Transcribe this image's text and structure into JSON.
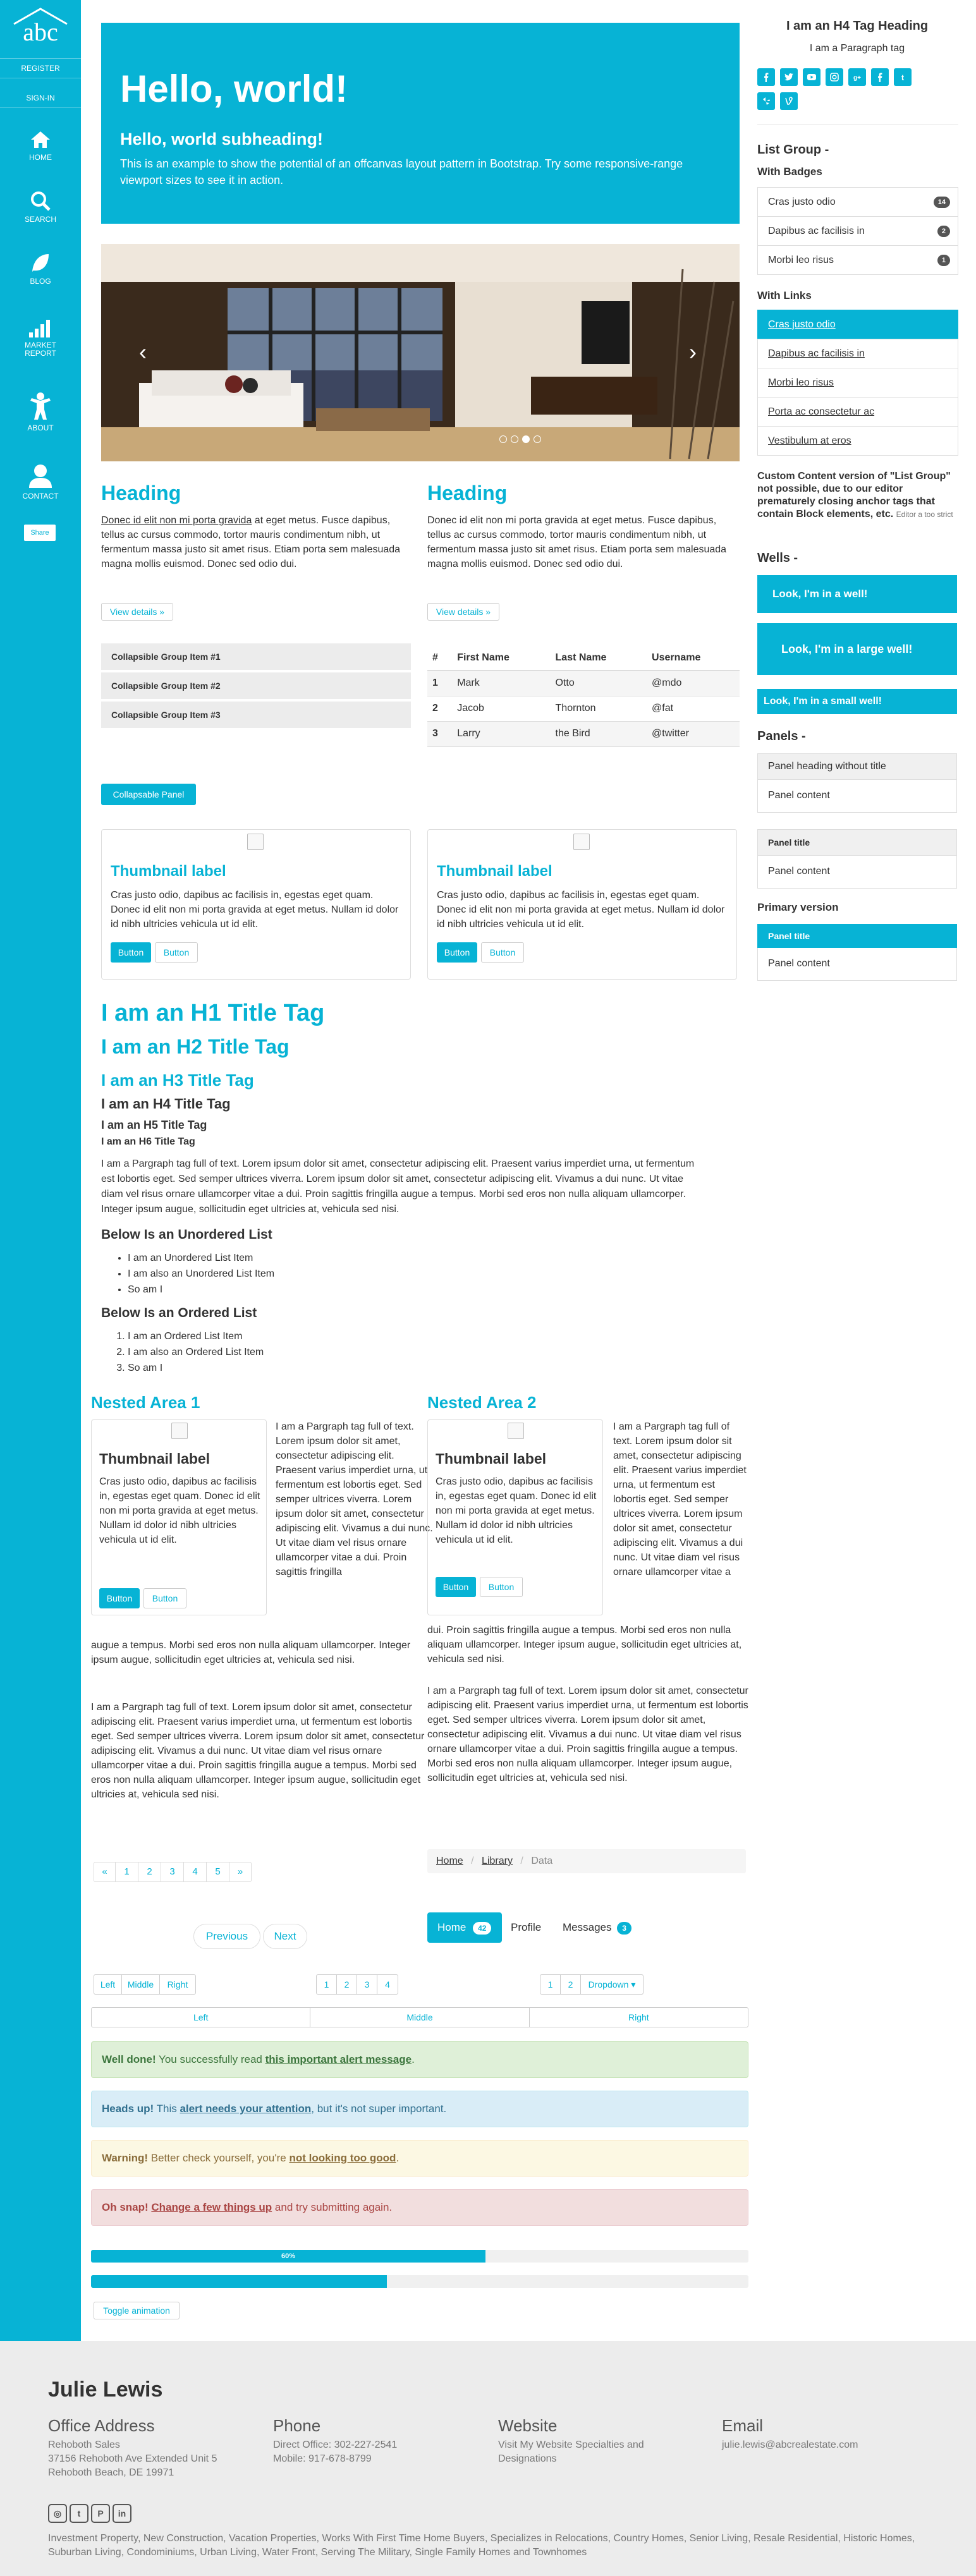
{
  "sidebar": {
    "logo_text": "abc",
    "register": "REGISTER",
    "signin": "SIGN-IN",
    "nav": [
      {
        "label": "HOME",
        "icon": "home-icon"
      },
      {
        "label": "SEARCH",
        "icon": "search-icon"
      },
      {
        "label": "BLOG",
        "icon": "leaf-icon"
      },
      {
        "label": "MARKET\nREPORT",
        "icon": "bar-chart-icon"
      },
      {
        "label": "ABOUT",
        "icon": "person-icon"
      },
      {
        "label": "CONTACT",
        "icon": "user-icon"
      }
    ],
    "share": "Share"
  },
  "jumbotron": {
    "title": "Hello, world!",
    "subtitle": "Hello, world subheading!",
    "text": "This is an example to show the potential of an offcanvas layout pattern in Bootstrap. Try some responsive-range viewport sizes to see it in action."
  },
  "columns": [
    {
      "heading": "Heading",
      "link": "Donec id elit non mi porta gravida",
      "text": " at eget metus. Fusce dapibus, tellus ac cursus commodo, tortor mauris condimentum nibh, ut fermentum massa justo sit amet risus. Etiam porta sem malesuada magna mollis euismod. Donec sed odio dui.",
      "button": "View details »"
    },
    {
      "heading": "Heading",
      "link": "",
      "text": "Donec id elit non mi porta gravida at eget metus. Fusce dapibus, tellus ac cursus commodo, tortor mauris condimentum nibh, ut fermentum massa justo sit amet risus. Etiam porta sem malesuada magna mollis euismod. Donec sed odio dui.",
      "button": "View details »"
    }
  ],
  "collapsible": [
    "Collapsible Group Item #1",
    "Collapsible Group Item #2",
    "Collapsible Group Item #3"
  ],
  "table": {
    "headers": [
      "#",
      "First Name",
      "Last Name",
      "Username"
    ],
    "rows": [
      [
        "1",
        "Mark",
        "Otto",
        "@mdo"
      ],
      [
        "2",
        "Jacob",
        "Thornton",
        "@fat"
      ],
      [
        "3",
        "Larry",
        "the Bird",
        "@twitter"
      ]
    ]
  },
  "collapsable_panel": "Collapsable Panel",
  "thumbnails": [
    {
      "title": "Thumbnail label",
      "text": "Cras justo odio, dapibus ac facilisis in, egestas eget quam. Donec id elit non mi porta gravida at eget metus. Nullam id dolor id nibh ultricies vehicula ut id elit.",
      "btn1": "Button",
      "btn2": "Button"
    },
    {
      "title": "Thumbnail label",
      "text": "Cras justo odio, dapibus ac facilisis in, egestas eget quam. Donec id elit non mi porta gravida at eget metus. Nullam id dolor id nibh ultricies vehicula ut id elit.",
      "btn1": "Button",
      "btn2": "Button"
    }
  ],
  "typography": {
    "h1": "I am an H1 Title Tag",
    "h2": "I am an H2 Title Tag",
    "h3": "I am an H3 Title Tag",
    "h4": "I am an H4 Title Tag",
    "h5": "I am an H5 Title Tag",
    "h6": "I am an H6 Title Tag",
    "paragraph": "I am a Pargraph tag full of text. Lorem ipsum dolor sit amet, consectetur adipiscing elit. Praesent varius imperdiet urna, ut fermentum est lobortis eget. Sed semper ultrices viverra. Lorem ipsum dolor sit amet, consectetur adipiscing elit. Vivamus a dui nunc. Ut vitae diam vel risus ornare ullamcorper vitae a dui. Proin sagittis fringilla augue a tempus. Morbi sed eros non nulla aliquam ullamcorper. Integer ipsum augue, sollicitudin eget ultricies at, vehicula sed nisi.",
    "ul_title": "Below Is an Unordered List",
    "ul": [
      "I am an Unordered List Item",
      "I am also an Unordered List Item",
      "So am I"
    ],
    "ol_title": "Below Is an Ordered List",
    "ol": [
      "I am an Ordered List Item",
      "I am also an Ordered List Item",
      "So am I"
    ]
  },
  "nested": [
    {
      "title": "Nested Area 1",
      "thumb_title": "Thumbnail label",
      "thumb_text": "Cras justo odio, dapibus ac facilisis in, egestas eget quam. Donec id elit non mi porta gravida at eget metus. Nullam id dolor id nibh ultricies vehicula ut id elit.",
      "btn1": "Button",
      "btn2": "Button",
      "side_text": "I am a Pargraph tag full of text. Lorem ipsum dolor sit amet, consectetur adipiscing elit. Praesent varius imperdiet urna, ut fermentum est lobortis eget. Sed semper ultrices viverra. Lorem ipsum dolor sit amet, consectetur adipiscing elit. Vivamus a dui nunc. Ut vitae diam vel risus ornare ullamcorper vitae a dui. Proin sagittis fringilla",
      "cont_text": "augue a tempus. Morbi sed eros non nulla aliquam ullamcorper. Integer ipsum augue, sollicitudin eget ultricies at, vehicula sed nisi.",
      "para2": "I am a Pargraph tag full of text. Lorem ipsum dolor sit amet, consectetur adipiscing elit. Praesent varius imperdiet urna, ut fermentum est lobortis eget. Sed semper ultrices viverra. Lorem ipsum dolor sit amet, consectetur adipiscing elit. Vivamus a dui nunc. Ut vitae diam vel risus ornare ullamcorper vitae a dui. Proin sagittis fringilla augue a tempus. Morbi sed eros non nulla aliquam ullamcorper. Integer ipsum augue, sollicitudin eget ultricies at, vehicula sed nisi."
    },
    {
      "title": "Nested Area 2",
      "thumb_title": "Thumbnail label",
      "thumb_text": "Cras justo odio, dapibus ac facilisis in, egestas eget quam. Donec id elit non mi porta gravida at eget metus. Nullam id dolor id nibh ultricies vehicula ut id elit.",
      "btn1": "Button",
      "btn2": "Button",
      "side_text": "I am a Pargraph tag full of text. Lorem ipsum dolor sit amet, consectetur adipiscing elit. Praesent varius imperdiet urna, ut fermentum est lobortis eget. Sed semper ultrices viverra. Lorem ipsum dolor sit amet, consectetur adipiscing elit. Vivamus a dui nunc. Ut vitae diam vel risus ornare ullamcorper vitae a",
      "cont_text": "dui. Proin sagittis fringilla augue a tempus. Morbi sed eros non nulla aliquam ullamcorper. Integer ipsum augue, sollicitudin eget ultricies at, vehicula sed nisi.",
      "para2": "I am a Pargraph tag full of text. Lorem ipsum dolor sit amet, consectetur adipiscing elit. Praesent varius imperdiet urna, ut fermentum est lobortis eget. Sed semper ultrices viverra. Lorem ipsum dolor sit amet, consectetur adipiscing elit. Vivamus a dui nunc. Ut vitae diam vel risus ornare ullamcorper vitae a dui. Proin sagittis fringilla augue a tempus. Morbi sed eros non nulla aliquam ullamcorper. Integer ipsum augue, sollicitudin eget ultricies at, vehicula sed nisi."
    }
  ],
  "pagination": [
    "«",
    "1",
    "2",
    "3",
    "4",
    "5",
    "»"
  ],
  "breadcrumb": {
    "home": "Home",
    "library": "Library",
    "data": "Data",
    "sep": "/"
  },
  "pager": {
    "prev": "Previous",
    "next": "Next"
  },
  "pills": {
    "home": "Home",
    "home_badge": "42",
    "profile": "Profile",
    "messages": "Messages",
    "messages_badge": "3"
  },
  "btn_group1": [
    "Left",
    "Middle",
    "Right"
  ],
  "btn_group2": [
    "1",
    "2",
    "3",
    "4"
  ],
  "btn_group3": [
    "1",
    "2",
    "Dropdown ▾"
  ],
  "justified": [
    "Left",
    "Middle",
    "Right"
  ],
  "alerts": [
    {
      "strong": "Well done!",
      "text1": " You successfully read ",
      "link": "this important alert message",
      "text2": ".",
      "bg": "#dff0d8",
      "border": "#c3e2b3",
      "color": "#3c763d"
    },
    {
      "strong": "Heads up!",
      "text1": " This ",
      "link": "alert needs your attention",
      "text2": ", but it's not super important.",
      "bg": "#d9edf7",
      "border": "#bce8f1",
      "color": "#31708f"
    },
    {
      "strong": "Warning!",
      "text1": " Better check yourself, you're ",
      "link": "not looking too good",
      "text2": ".",
      "bg": "#fcf8e3",
      "border": "#faebcc",
      "color": "#8a6d3b"
    },
    {
      "strong": "Oh snap!",
      "text1": " ",
      "link": "Change a few things up",
      "text2": " and try submitting again.",
      "bg": "#f2dede",
      "border": "#ebccd1",
      "color": "#a94442"
    }
  ],
  "progress": [
    {
      "label": "60%",
      "value": 0.6
    },
    {
      "label": "",
      "value": 0.45
    }
  ],
  "toggle_animation": "Toggle animation",
  "right": {
    "h4": "I am an H4 Tag Heading",
    "p": "I am a Paragraph tag",
    "social_icons": [
      "facebook-icon",
      "twitter-icon",
      "youtube-icon",
      "instagram-icon",
      "google-plus-icon",
      "facebook-icon",
      "tumblr-icon",
      "yelp-icon",
      "vine-icon"
    ],
    "list_group_title": "List Group -",
    "with_badges": "With Badges",
    "badges_items": [
      {
        "label": "Cras justo odio",
        "badge": "14"
      },
      {
        "label": "Dapibus ac facilisis in",
        "badge": "2"
      },
      {
        "label": "Morbi leo risus",
        "badge": "1"
      }
    ],
    "with_links": "With Links",
    "links_items": [
      "Cras justo odio",
      "Dapibus ac facilisis in",
      "Morbi leo risus",
      "Porta ac consectetur ac",
      "Vestibulum at eros"
    ],
    "custom_note": "Custom Content version of \"List Group\" not possible, due to our editor prematurely closing anchor tags that contain Block elements, etc.",
    "custom_note_small": "Editor a too strict",
    "wells_title": "Wells -",
    "wells": [
      "Look, I'm in a well!",
      "Look, I'm in a large well!",
      "Look, I'm in a small well!"
    ],
    "panels_title": "Panels -",
    "panel1_head": "Panel heading without title",
    "panel1_body": "Panel content",
    "panel2_head": "Panel title",
    "panel2_body": "Panel content",
    "primary_title": "Primary version",
    "panel3_head": "Panel title",
    "panel3_body": "Panel content"
  },
  "footer": {
    "name": "Julie Lewis",
    "office_title": "Office Address",
    "office_lines": [
      "Rehoboth Sales",
      "37156 Rehoboth Ave Extended Unit 5",
      "Rehoboth Beach, DE 19971"
    ],
    "phone_title": "Phone",
    "phone_lines": [
      "Direct Office: 302-227-2541",
      "Mobile: 917-678-8799"
    ],
    "website_title": "Website",
    "website_lines": [
      "Visit My Website Specialties and Designations"
    ],
    "email_title": "Email",
    "email_lines": [
      "julie.lewis@abcrealestate.com"
    ],
    "social": [
      "instagram-icon",
      "twitter-icon",
      "pinterest-icon",
      "linkedin-icon"
    ],
    "tags": "Investment Property, New Construction, Vacation Properties, Works With First Time Home Buyers, Specializes in Relocations, Country Homes, Senior Living, Resale Residential, Historic Homes, Suburban Living, Condominiums, Urban Living, Water Front, Serving The Military, Single Family Homes and Townhomes"
  },
  "colors": {
    "accent": "#07b3d5"
  }
}
